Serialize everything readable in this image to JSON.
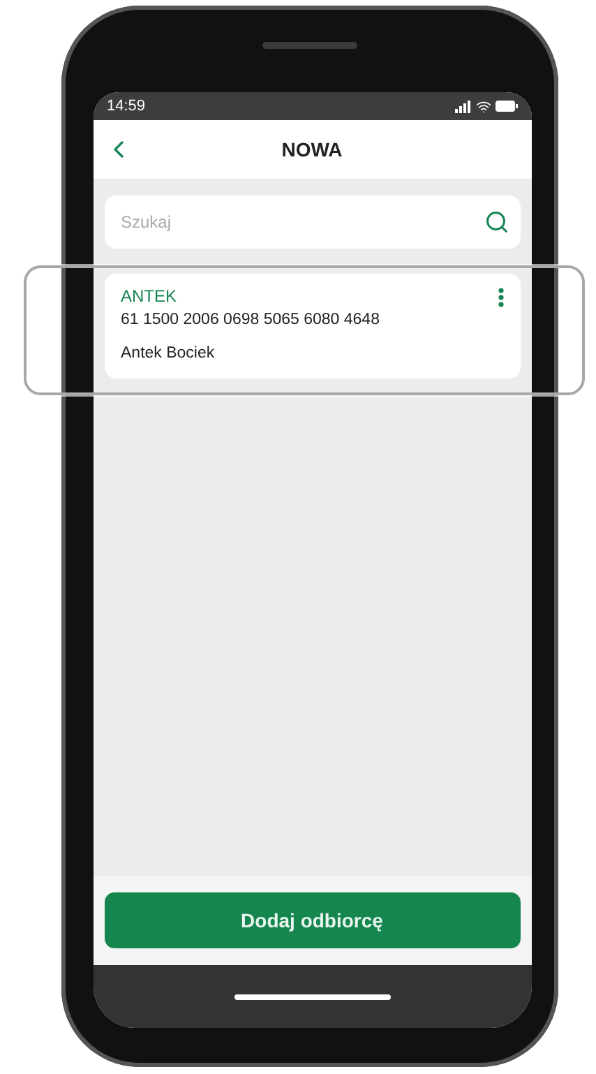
{
  "status_bar": {
    "time": "14:59"
  },
  "header": {
    "title": "NOWA"
  },
  "search": {
    "placeholder": "Szukaj"
  },
  "recipients": [
    {
      "name": "ANTEK",
      "account": "61 1500 2006 0698 5065 6080 4648",
      "owner": "Antek Bociek",
      "highlighted": true
    }
  ],
  "primary_button": {
    "label": "Dodaj odbiorcę"
  }
}
